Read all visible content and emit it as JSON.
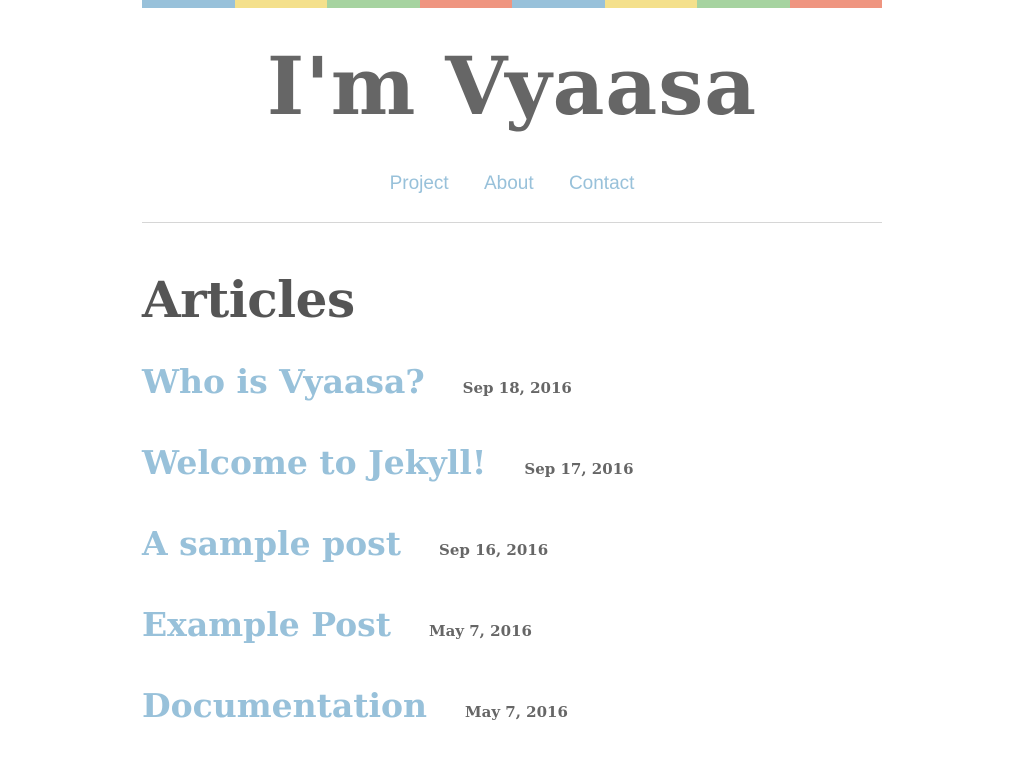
{
  "colors": {
    "stripe": [
      "#98c1da",
      "#f4e08c",
      "#a6d3a0",
      "#ef9580",
      "#98c1da",
      "#f4e08c",
      "#a6d3a0",
      "#ef9580"
    ],
    "link": "#98c1da",
    "title": "#666666",
    "heading": "#555555"
  },
  "site": {
    "title": "I'm Vyaasa"
  },
  "nav": {
    "items": [
      {
        "label": "Project"
      },
      {
        "label": "About"
      },
      {
        "label": "Contact"
      }
    ]
  },
  "articles": {
    "heading": "Articles",
    "posts": [
      {
        "title": "Who is Vyaasa?",
        "date": "Sep 18, 2016"
      },
      {
        "title": "Welcome to Jekyll!",
        "date": "Sep 17, 2016"
      },
      {
        "title": "A sample post",
        "date": "Sep 16, 2016"
      },
      {
        "title": "Example Post",
        "date": "May 7, 2016"
      },
      {
        "title": "Documentation",
        "date": "May 7, 2016"
      }
    ]
  }
}
